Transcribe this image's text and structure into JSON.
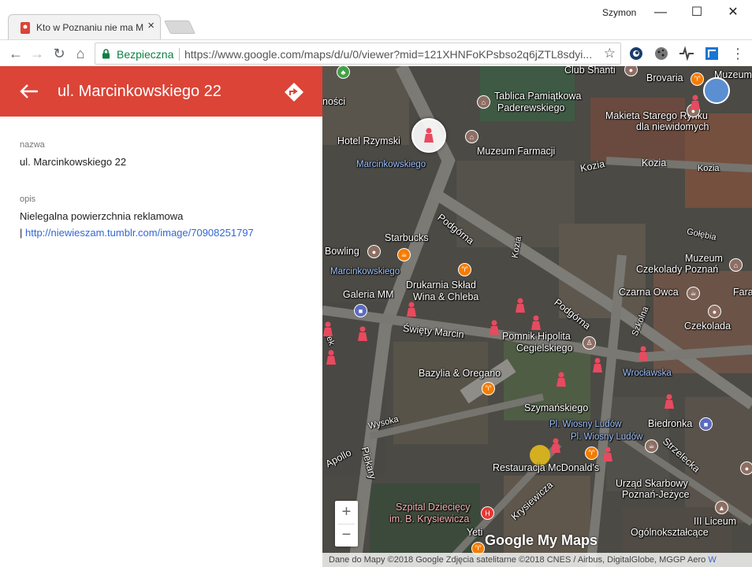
{
  "browser": {
    "tab_title": "Kto w Poznaniu nie ma M",
    "tab_close": "×",
    "profile_name": "Szymon",
    "win_min": "—",
    "win_max": "☐",
    "win_close": "✕",
    "secure_label": "Bezpieczna",
    "url": "https://www.google.com/maps/d/u/0/viewer?mid=121XHNFoKPsbso2q6jZTL8sdyi...",
    "nav_back": "←",
    "nav_forward": "→",
    "nav_reload": "↻",
    "nav_home": "⌂",
    "bookmark_star": "☆",
    "menu_dots": "⋮"
  },
  "panel": {
    "title": "ul. Marcinkowskiego 22",
    "fields": [
      {
        "label": "nazwa",
        "value": "ul. Marcinkowskiego 22"
      },
      {
        "label": "opis",
        "value": "Nielegalna powierzchnia reklamowa",
        "link_prefix": "|",
        "link": "http://niewieszam.tumblr.com/image/70908251797"
      }
    ]
  },
  "map": {
    "labels": {
      "club_shanti": "Club Shanti",
      "brovaria": "Brovaria",
      "muzeum_top": "Muzeum",
      "nosci": "ności",
      "tablica": "Tablica Pamiątkowa",
      "paderewskiego": "Paderewskiego",
      "makieta1": "Makieta Starego Rynku",
      "makieta2": "dla niewidomych",
      "hotel_rzymski": "Hotel Rzymski",
      "muzeum_farmacji": "Muzeum Farmacji",
      "kozia1": "Kozia",
      "kozia2": "Kozia",
      "kozia3": "Kozia",
      "kozia4": "Kozia",
      "marcinkowskiego_stop1": "Marcinkowskiego",
      "podgorna1": "Podgórna",
      "podgorna2": "Podgórna",
      "golebia": "Gołębia",
      "starbucks": "Starbucks",
      "bowling": "Bowling",
      "muzeum_czek1": "Muzeum",
      "muzeum_czek2": "Czekolady Poznań",
      "marcinkowskiego_stop2": "Marcinkowskiego",
      "drukarnia1": "Drukarnia Skład",
      "drukarnia2": "Wina & Chleba",
      "galeria_mm": "Galeria MM",
      "czarna_owca": "Czarna Owca",
      "fara": "Fara",
      "szkolna": "Szkolna",
      "czekolada": "Czekolada",
      "swiety_marcin": "Święty Marcin",
      "pomnik1": "Pomnik Hipolita",
      "pomnik2": "Cegielskiego",
      "wroclawska": "Wrocławska",
      "bazylia": "Bazylia & Oregano",
      "szymanskiego": "Szymańskiego",
      "wysoka": "Wysoka",
      "pl_wiosny1": "Pl. Wiosny Ludów",
      "pl_wiosny2": "Pl. Wiosny Ludów",
      "biedronka": "Biedronka",
      "apollo": "Apollo",
      "piekary": "Piekary",
      "strzelecka": "Strzelecka",
      "mcdonalds": "Restauracja McDonald's",
      "urzad1": "Urząd Skarbowy",
      "urzad2": "Poznań-Jeżyce",
      "krysiewicza": "Krysiewicza",
      "szpital1": "Szpital Dziecięcy",
      "szpital2": "im. B. Krysiewicza",
      "liceum": "III Liceum",
      "ogolno": "Ogólnokształcące",
      "yeti": "Yeti",
      "dek": "dek",
      "brand": "Google My Maps"
    },
    "zoom_in": "+",
    "zoom_out": "−",
    "attribution": "Dane do Mapy ©2018 Google Zdjęcia satelitarne ©2018 CNES / Airbus, DigitalGlobe, MGGP Aero",
    "attribution_tail": "W"
  },
  "colors": {
    "header_red": "#db4437",
    "link_blue": "#3367d6",
    "secure_green": "#0b8043",
    "pin_red": "#e84a5f"
  }
}
